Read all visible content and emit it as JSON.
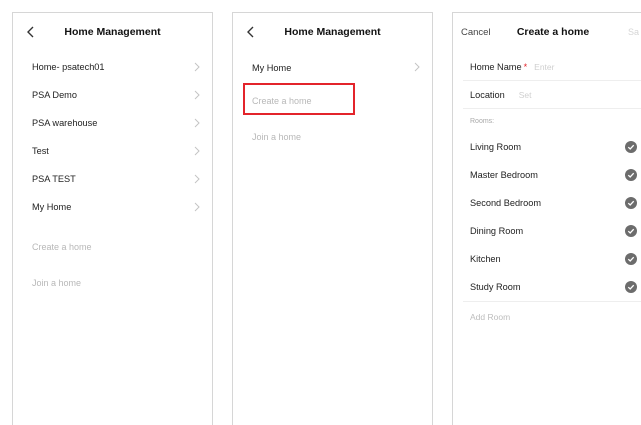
{
  "panel1": {
    "title": "Home Management",
    "homes": [
      "Home- psatech01",
      "PSA Demo",
      "PSA warehouse",
      "Test",
      "PSA TEST",
      "My Home"
    ],
    "create_label": "Create a home",
    "join_label": "Join a home"
  },
  "panel2": {
    "title": "Home Management",
    "home": "My Home",
    "create_label": "Create a home",
    "join_label": "Join a home"
  },
  "panel3": {
    "cancel_label": "Cancel",
    "title": "Create a home",
    "save_label": "Sa",
    "home_name_label": "Home Name",
    "required_mark": "*",
    "home_name_placeholder": "Enter",
    "location_label": "Location",
    "location_value": "Set",
    "rooms_label": "Rooms:",
    "rooms": [
      "Living Room",
      "Master Bedroom",
      "Second Bedroom",
      "Dining Room",
      "Kitchen",
      "Study Room"
    ],
    "add_room_label": "Add Room"
  },
  "colors": {
    "highlight": "#e3242b",
    "check": "#6c6c6c",
    "muted_text": "#b8b8b8"
  },
  "icons": {
    "back": "chevron-left-icon",
    "row_arrow": "chevron-right-icon",
    "room_selected": "check-circle-icon"
  }
}
